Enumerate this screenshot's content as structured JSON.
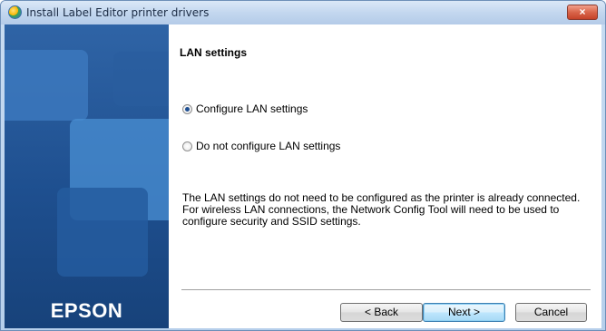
{
  "window": {
    "title": "Install Label Editor printer drivers",
    "close_label": "×"
  },
  "sidebar": {
    "brand": "EPSON"
  },
  "content": {
    "heading": "LAN settings",
    "options": [
      {
        "label": "Configure LAN settings",
        "selected": true
      },
      {
        "label": "Do not configure LAN settings",
        "selected": false
      }
    ],
    "info_line1": "The LAN settings do not need to be configured as the printer is already connected.",
    "info_line2": "For wireless LAN connections, the Network Config Tool will need to be used to configure security and SSID settings."
  },
  "buttons": {
    "back": "< Back",
    "next": "Next >",
    "cancel": "Cancel"
  },
  "colors": {
    "sidebar": "#1e4f8f",
    "close_button": "#c5432a"
  }
}
